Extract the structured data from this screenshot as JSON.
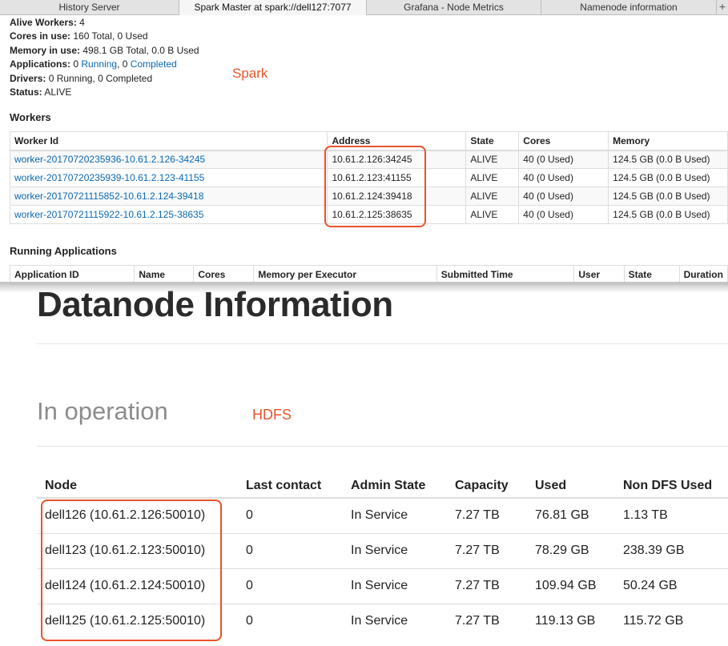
{
  "tabs": [
    {
      "label": "History Server"
    },
    {
      "label": "Spark Master at spark://dell127:7077"
    },
    {
      "label": "Grafana - Node Metrics"
    },
    {
      "label": "Namenode information"
    }
  ],
  "tab_add": "+",
  "spark": {
    "summary": {
      "alive_workers_label": "Alive Workers:",
      "alive_workers": "4",
      "cores_label": "Cores in use:",
      "cores": "160 Total, 0 Used",
      "memory_label": "Memory in use:",
      "memory": "498.1 GB Total, 0.0 B Used",
      "apps_label": "Applications:",
      "apps_running_count": "0",
      "apps_running": "Running",
      "apps_sep": ", 0 ",
      "apps_completed": "Completed",
      "drivers_label": "Drivers:",
      "drivers": "0 Running, 0 Completed",
      "status_label": "Status:",
      "status": "ALIVE"
    },
    "annotation": "Spark",
    "workers_heading": "Workers",
    "workers_columns": [
      "Worker Id",
      "Address",
      "State",
      "Cores",
      "Memory"
    ],
    "workers": [
      {
        "id": "worker-20170720235936-10.61.2.126-34245",
        "address": "10.61.2.126:34245",
        "state": "ALIVE",
        "cores": "40 (0 Used)",
        "memory": "124.5 GB (0.0 B Used)"
      },
      {
        "id": "worker-20170720235939-10.61.2.123-41155",
        "address": "10.61.2.123:41155",
        "state": "ALIVE",
        "cores": "40 (0 Used)",
        "memory": "124.5 GB (0.0 B Used)"
      },
      {
        "id": "worker-20170721115852-10.61.2.124-39418",
        "address": "10.61.2.124:39418",
        "state": "ALIVE",
        "cores": "40 (0 Used)",
        "memory": "124.5 GB (0.0 B Used)"
      },
      {
        "id": "worker-20170721115922-10.61.2.125-38635",
        "address": "10.61.2.125:38635",
        "state": "ALIVE",
        "cores": "40 (0 Used)",
        "memory": "124.5 GB (0.0 B Used)"
      }
    ],
    "running_heading": "Running Applications",
    "running_columns": [
      "Application ID",
      "Name",
      "Cores",
      "Memory per Executor",
      "Submitted Time",
      "User",
      "State",
      "Duration"
    ]
  },
  "hdfs": {
    "title": "Datanode Information",
    "subtitle": "In operation",
    "annotation": "HDFS",
    "columns": [
      "Node",
      "Last contact",
      "Admin State",
      "Capacity",
      "Used",
      "Non DFS Used"
    ],
    "rows": [
      {
        "node": "dell126 (10.61.2.126:50010)",
        "last_contact": "0",
        "admin_state": "In Service",
        "capacity": "7.27 TB",
        "used": "76.81 GB",
        "non_dfs": "1.13 TB"
      },
      {
        "node": "dell123 (10.61.2.123:50010)",
        "last_contact": "0",
        "admin_state": "In Service",
        "capacity": "7.27 TB",
        "used": "78.29 GB",
        "non_dfs": "238.39 GB"
      },
      {
        "node": "dell124 (10.61.2.124:50010)",
        "last_contact": "0",
        "admin_state": "In Service",
        "capacity": "7.27 TB",
        "used": "109.94 GB",
        "non_dfs": "50.24 GB"
      },
      {
        "node": "dell125 (10.61.2.125:50010)",
        "last_contact": "0",
        "admin_state": "In Service",
        "capacity": "7.27 TB",
        "used": "119.13 GB",
        "non_dfs": "115.72 GB"
      }
    ]
  },
  "colors": {
    "link": "#0a69b4",
    "annotation": "#e8532a"
  }
}
